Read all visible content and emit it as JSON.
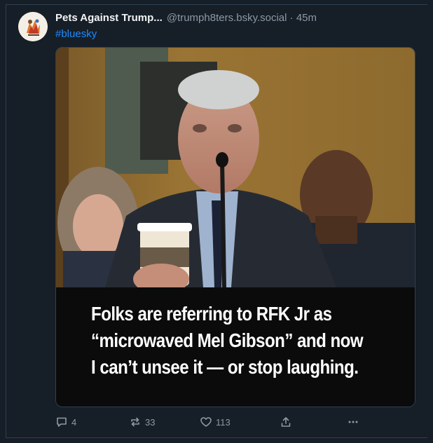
{
  "post": {
    "display_name": "Pets Against Trump...",
    "handle_time": "@trumph8ters.bsky.social · 45m",
    "hashtag": "#bluesky"
  },
  "media": {
    "caption_lines": [
      "Folks are referring to RFK Jr as",
      "“microwaved Mel Gibson” and now",
      "I can’t unsee it — or stop laughing."
    ]
  },
  "actions": {
    "reply_count": "4",
    "repost_count": "33",
    "like_count": "113"
  },
  "icons": [
    "reply-icon",
    "repost-icon",
    "like-icon",
    "share-icon",
    "more-icon"
  ],
  "colors": {
    "background": "#161e27",
    "link": "#208bfe",
    "muted": "#8d99a5",
    "text": "#f1f3f5"
  }
}
